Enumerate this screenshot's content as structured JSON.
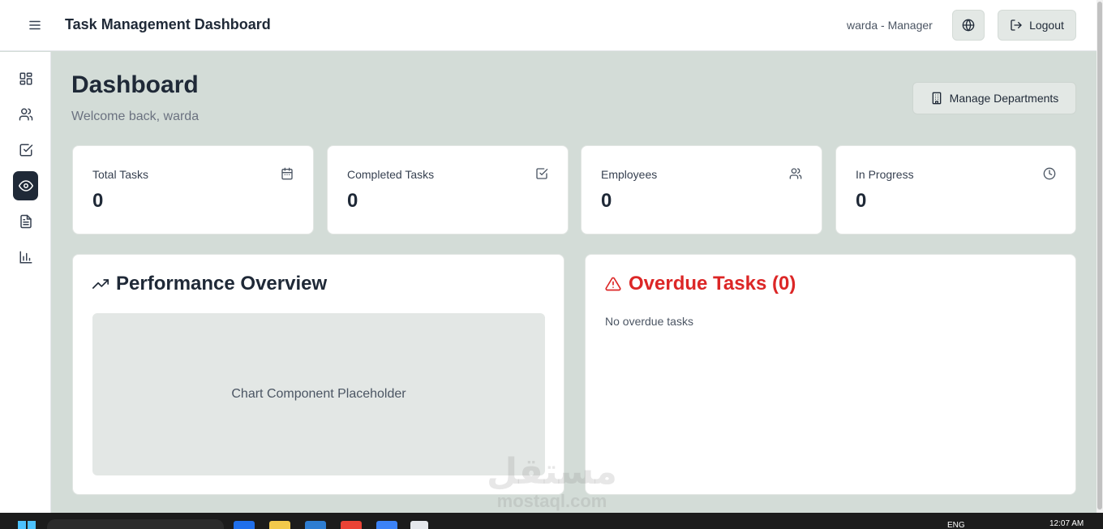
{
  "header": {
    "title": "Task Management Dashboard",
    "user": "warda - Manager",
    "logout_label": "Logout"
  },
  "sidebar": {
    "items": [
      {
        "icon": "layout-grid-icon"
      },
      {
        "icon": "users-icon"
      },
      {
        "icon": "check-square-icon"
      },
      {
        "icon": "eye-icon",
        "active": true
      },
      {
        "icon": "file-text-icon"
      },
      {
        "icon": "bar-chart-icon"
      }
    ]
  },
  "page": {
    "title": "Dashboard",
    "welcome": "Welcome back, warda",
    "manage_label": "Manage Departments"
  },
  "stats": [
    {
      "label": "Total Tasks",
      "value": "0",
      "icon": "calendar-icon"
    },
    {
      "label": "Completed Tasks",
      "value": "0",
      "icon": "check-square-icon"
    },
    {
      "label": "Employees",
      "value": "0",
      "icon": "users-icon"
    },
    {
      "label": "In Progress",
      "value": "0",
      "icon": "clock-icon"
    }
  ],
  "performance": {
    "title": "Performance Overview",
    "placeholder": "Chart Component Placeholder"
  },
  "overdue": {
    "title": "Overdue Tasks (0)",
    "empty": "No overdue tasks",
    "color": "#dc2626"
  },
  "watermark": {
    "arabic": "مستقل",
    "latin": "mostaql.com"
  },
  "taskbar": {
    "lang": "ENG",
    "time": "12:07 AM"
  },
  "colors": {
    "background": "#d3dcd7",
    "sidebar_active": "#1f2937"
  }
}
